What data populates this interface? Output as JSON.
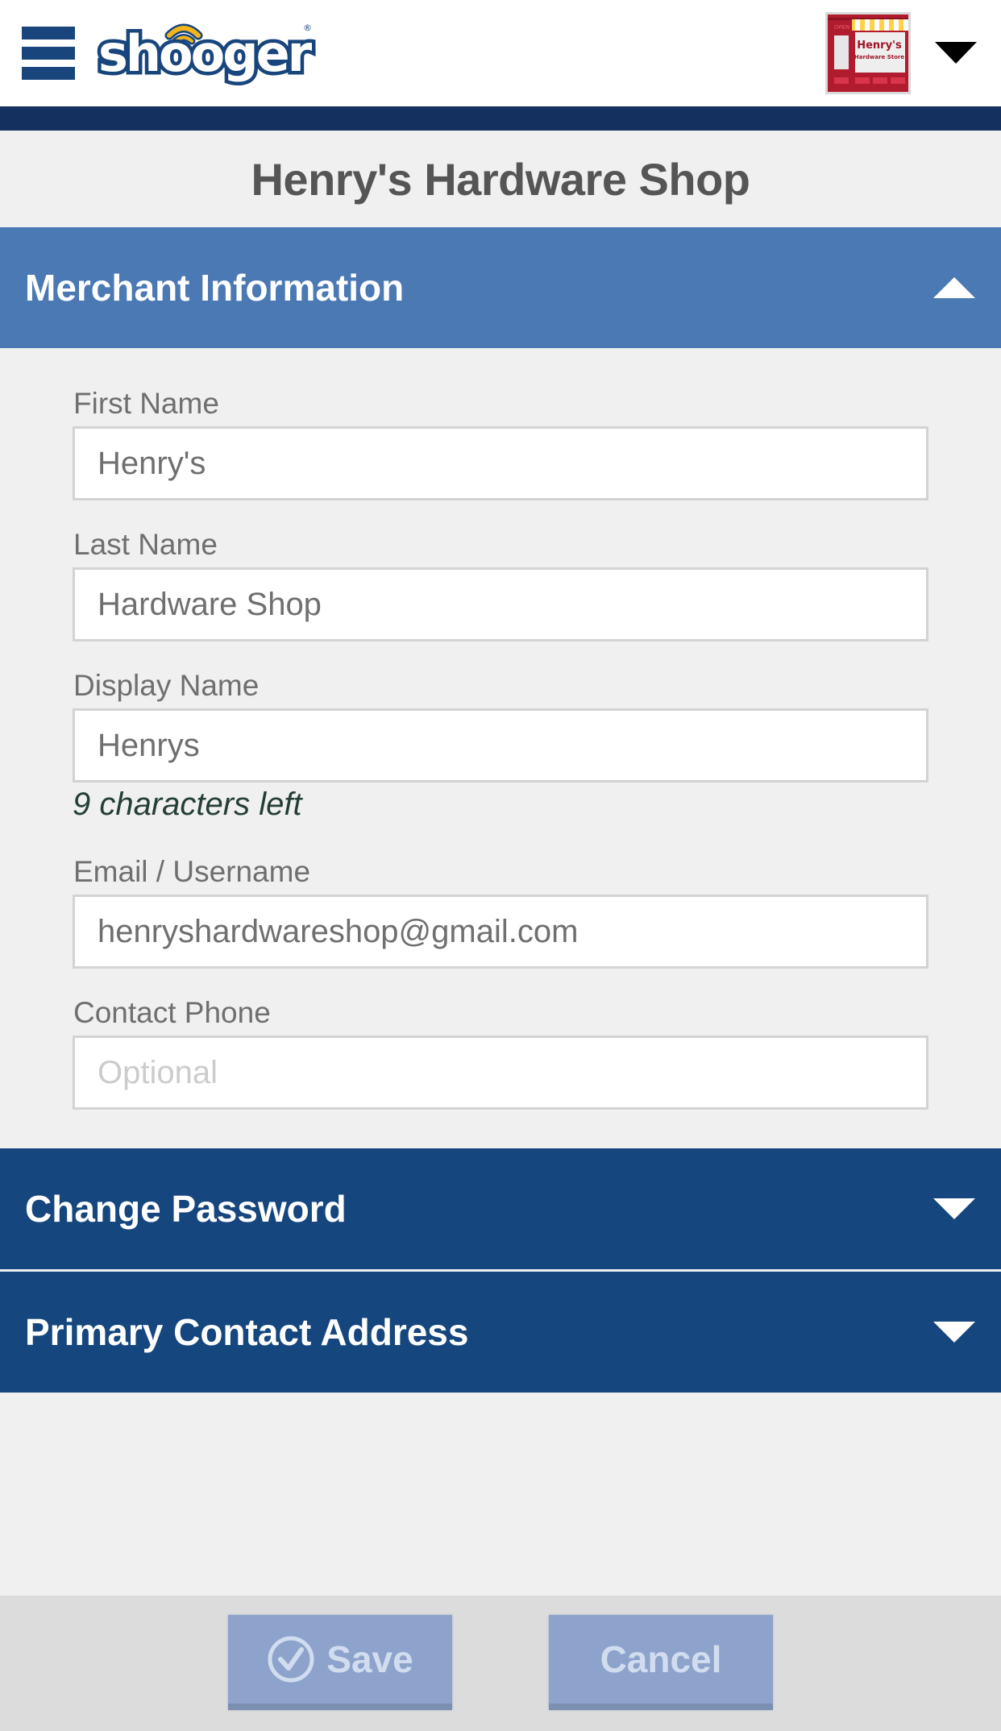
{
  "header": {
    "brand_name": "shooger",
    "menu_icon": "hamburger-menu-icon",
    "account_avatar": {
      "shop_sign_line1": "Henry's",
      "shop_sign_line2": "Hardware Store",
      "door_sign": "OPEN"
    },
    "account_menu_icon": "caret-down-icon"
  },
  "page": {
    "title": "Henry's Hardware Shop"
  },
  "sections": {
    "merchant": {
      "label": "Merchant Information",
      "expanded": true,
      "icon": "chevron-up-icon"
    },
    "password": {
      "label": "Change Password",
      "expanded": false,
      "icon": "chevron-down-icon"
    },
    "address": {
      "label": "Primary Contact Address",
      "expanded": false,
      "icon": "chevron-down-icon"
    }
  },
  "form": {
    "first_name": {
      "label": "First Name",
      "value": "Henry's"
    },
    "last_name": {
      "label": "Last Name",
      "value": "Hardware Shop"
    },
    "display_name": {
      "label": "Display Name",
      "value": "Henrys",
      "hint": "9 characters left"
    },
    "email": {
      "label": "Email / Username",
      "value": "henryshardwareshop@gmail.com"
    },
    "phone": {
      "label": "Contact Phone",
      "value": "",
      "placeholder": "Optional"
    }
  },
  "footer": {
    "save_label": "Save",
    "cancel_label": "Cancel"
  },
  "colors": {
    "brand_navy": "#14305f",
    "header_active": "#4a79b4",
    "header_collapsed": "#15467e",
    "button_disabled": "#8ea3cc",
    "logo_yellow": "#f2b51c"
  }
}
